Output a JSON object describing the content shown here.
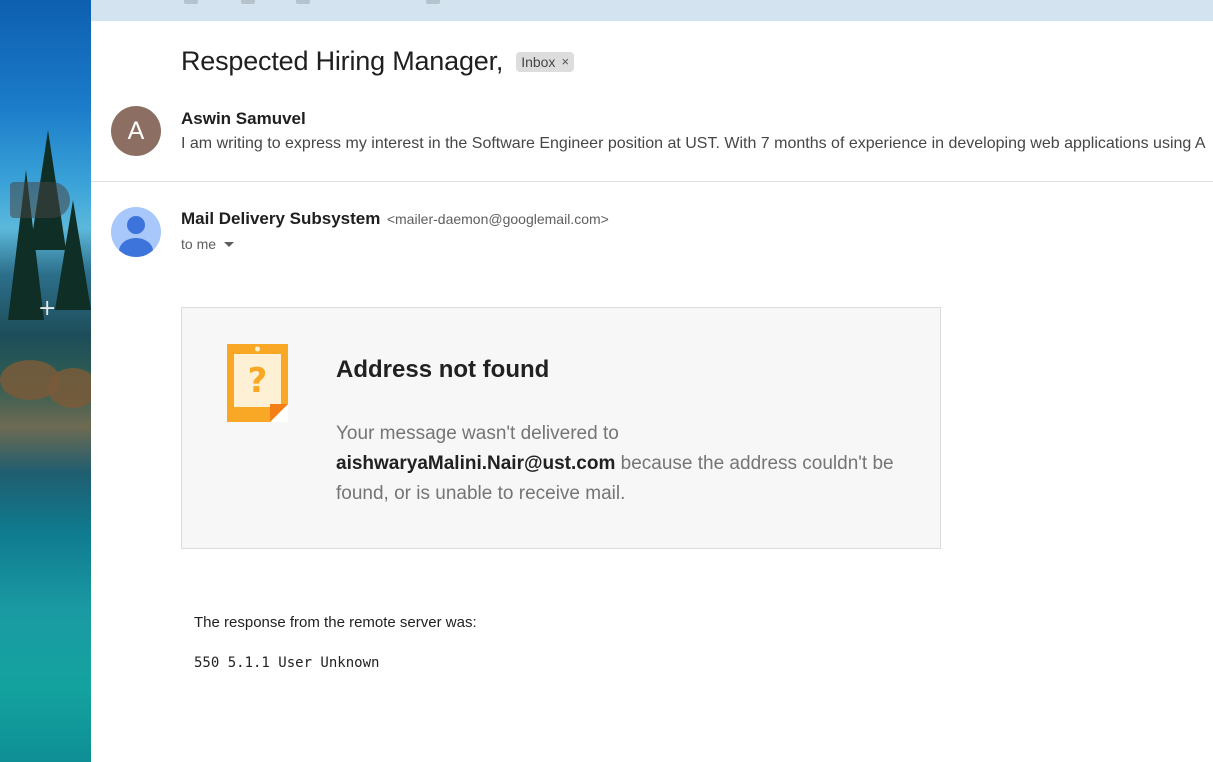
{
  "email": {
    "subject": "Respected Hiring Manager,",
    "label": {
      "name": "Inbox",
      "remove_symbol": "×"
    }
  },
  "thread": {
    "message1": {
      "avatar_letter": "A",
      "sender": "Aswin Samuvel",
      "snippet": "I am writing to express my interest in the Software Engineer position at UST. With 7 months of experience in developing web applications using A"
    },
    "message2": {
      "sender": "Mail Delivery Subsystem",
      "sender_email": "<mailer-daemon@googlemail.com>",
      "recipient": "to me"
    }
  },
  "bounce": {
    "icon": "question-note-icon",
    "title": "Address not found",
    "msg_prefix": "Your message wasn't delivered to",
    "address": "aishwaryaMalini.Nair@ust.com",
    "msg_suffix": "because the address couldn't be found, or is unable to receive mail."
  },
  "server_response": {
    "label": "The response from the remote server was:",
    "code": "550 5.1.1 User Unknown"
  },
  "colors": {
    "avatar_a": "#8d6e63",
    "avatar_generic": "#a8c7fa",
    "note_orange": "#f9a825",
    "topbar": "#d3e3f0"
  }
}
